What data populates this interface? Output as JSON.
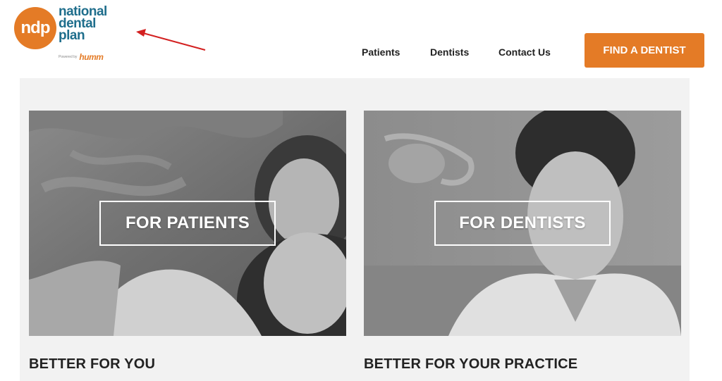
{
  "logo": {
    "monogram": "ndp",
    "line1": "national",
    "line2": "dental",
    "line3": "plan",
    "powered_by": "Powered by",
    "partner": "humm"
  },
  "nav": {
    "patients": "Patients",
    "dentists": "Dentists",
    "contact": "Contact Us"
  },
  "cta": {
    "label": "FIND A DENTIST"
  },
  "cards": {
    "patients": {
      "label": "FOR PATIENTS",
      "tagline": "BETTER FOR YOU"
    },
    "dentists": {
      "label": "FOR DENTISTS",
      "tagline": "BETTER FOR YOUR PRACTICE"
    }
  },
  "colors": {
    "brand_orange": "#e47b26",
    "brand_teal": "#1f6e8c",
    "annotation_arrow": "#d32020",
    "panel_bg": "#f2f2f2"
  }
}
